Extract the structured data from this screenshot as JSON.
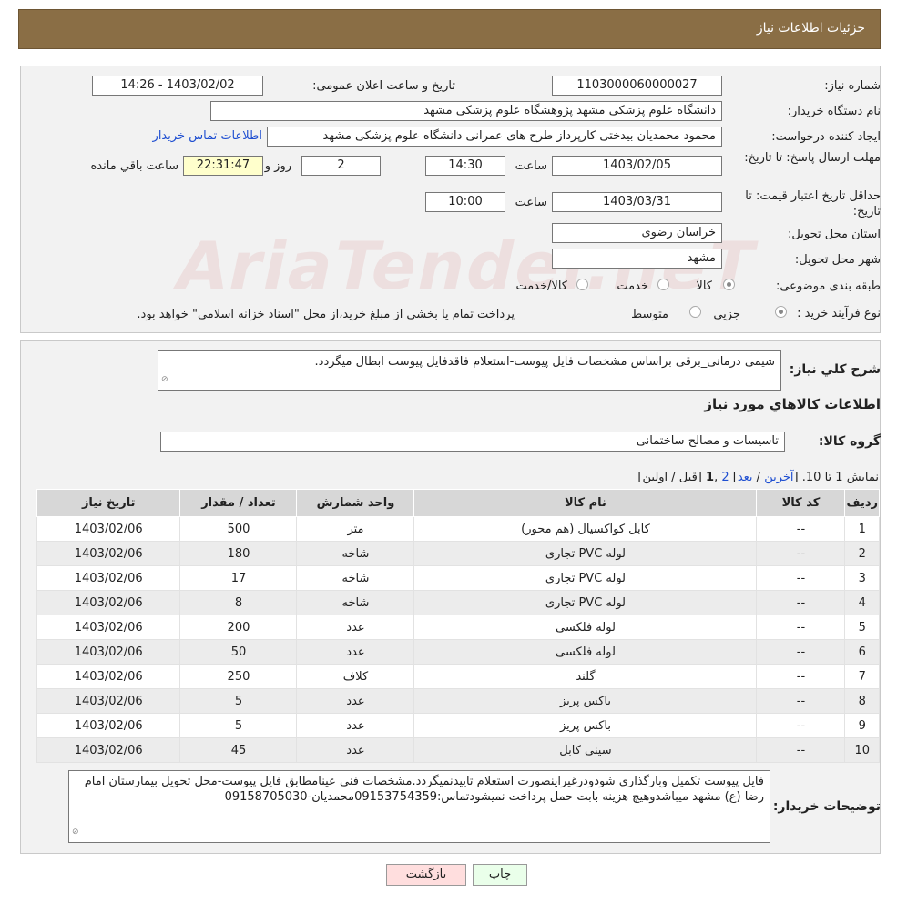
{
  "header": {
    "title": "جزئیات اطلاعات نیاز"
  },
  "fields": {
    "need_number_label": "شماره نیاز:",
    "need_number": "1103000060000027",
    "announce_label": "تاریخ و ساعت اعلان عمومی:",
    "announce_value": "1403/02/02 - 14:26",
    "buyer_org_label": "نام دستگاه خریدار:",
    "buyer_org": "دانشگاه علوم پزشکی مشهد   پژوهشگاه علوم پزشکی مشهد",
    "requester_label": "ایجاد کننده درخواست:",
    "requester": "محمود محمدیان بیدختی کارپرداز طرح های عمرانی دانشگاه علوم پزشکی مشهد",
    "contact_link": "اطلاعات تماس خریدار",
    "deadline_label": "مهلت ارسال پاسخ: تا تاریخ:",
    "deadline_date": "1403/02/05",
    "time_label": "ساعت",
    "deadline_time": "14:30",
    "days_value": "2",
    "days_label": "روز و",
    "remaining_value": "22:31:47",
    "remaining_label": "ساعت باقي مانده",
    "validity_label": "حداقل تاریخ اعتبار قیمت: تا تاریخ:",
    "validity_date": "1403/03/31",
    "validity_time": "10:00",
    "province_label": "استان محل تحویل:",
    "province": "خراسان رضوی",
    "city_label": "شهر محل تحویل:",
    "city": "مشهد",
    "category_label": "طبقه بندی موضوعی:",
    "category_opt1": "کالا",
    "category_opt2": "خدمت",
    "category_opt3": "کالا/خدمت",
    "process_label": "نوع فرآیند خرید :",
    "process_opt1": "جزیی",
    "process_opt2": "متوسط",
    "process_note": "پرداخت تمام یا بخشی از مبلغ خرید،از محل \"اسناد خزانه اسلامی\" خواهد بود."
  },
  "summary": {
    "label": "شرح کلي نياز:",
    "text": "شیمی درمانی_برقی براساس مشخصات فایل پیوست-استعلام فاقدفایل پیوست ابطال میگردد.",
    "goods_title": "اطلاعات کالاهاي مورد نياز",
    "group_label": "گروه کالا:",
    "group_value": "تاسیسات و مصالح ساختمانی"
  },
  "pager": {
    "prefix": "نمایش 1 تا 10.",
    "last": "آخرین",
    "next": "بعد",
    "page2": "2",
    "current": "1",
    "rest": "[قبل / اولین]"
  },
  "table": {
    "headers": [
      "ردیف",
      "کد کالا",
      "نام کالا",
      "واحد شمارش",
      "تعداد / مقدار",
      "تاریخ نیاز"
    ],
    "rows": [
      [
        "1",
        "--",
        "کابل کواکسیال (هم محور)",
        "متر",
        "500",
        "1403/02/06"
      ],
      [
        "2",
        "--",
        "لوله PVC تجاری",
        "شاخه",
        "180",
        "1403/02/06"
      ],
      [
        "3",
        "--",
        "لوله PVC تجاری",
        "شاخه",
        "17",
        "1403/02/06"
      ],
      [
        "4",
        "--",
        "لوله PVC تجاری",
        "شاخه",
        "8",
        "1403/02/06"
      ],
      [
        "5",
        "--",
        "لوله فلکسی",
        "عدد",
        "200",
        "1403/02/06"
      ],
      [
        "6",
        "--",
        "لوله فلکسی",
        "عدد",
        "50",
        "1403/02/06"
      ],
      [
        "7",
        "--",
        "گلند",
        "کلاف",
        "250",
        "1403/02/06"
      ],
      [
        "8",
        "--",
        "باکس پریز",
        "عدد",
        "5",
        "1403/02/06"
      ],
      [
        "9",
        "--",
        "باکس پریز",
        "عدد",
        "5",
        "1403/02/06"
      ],
      [
        "10",
        "--",
        "سینی کابل",
        "عدد",
        "45",
        "1403/02/06"
      ]
    ]
  },
  "buyer_notes": {
    "label": "توضیحات خریدار:",
    "text": "فایل پیوست تکمیل وبارگذاری شودودرغیراینصورت استعلام تاییدنمیگردد.مشخصات فنی عینامطابق فایل پیوست-محل تحویل بیمارستان امام رضا (ع) مشهد میباشدوهیچ هزینه بابت حمل پرداخت نمیشودتماس:09153754359محمدیان-09158705030"
  },
  "buttons": {
    "print": "چاپ",
    "back": "بازگشت"
  },
  "watermark": "AriaTender.neT",
  "colors": {
    "header": "#8a6e45",
    "link": "#1f4fd1",
    "back_button": "#ffdede",
    "print_button": "#eaffea"
  }
}
